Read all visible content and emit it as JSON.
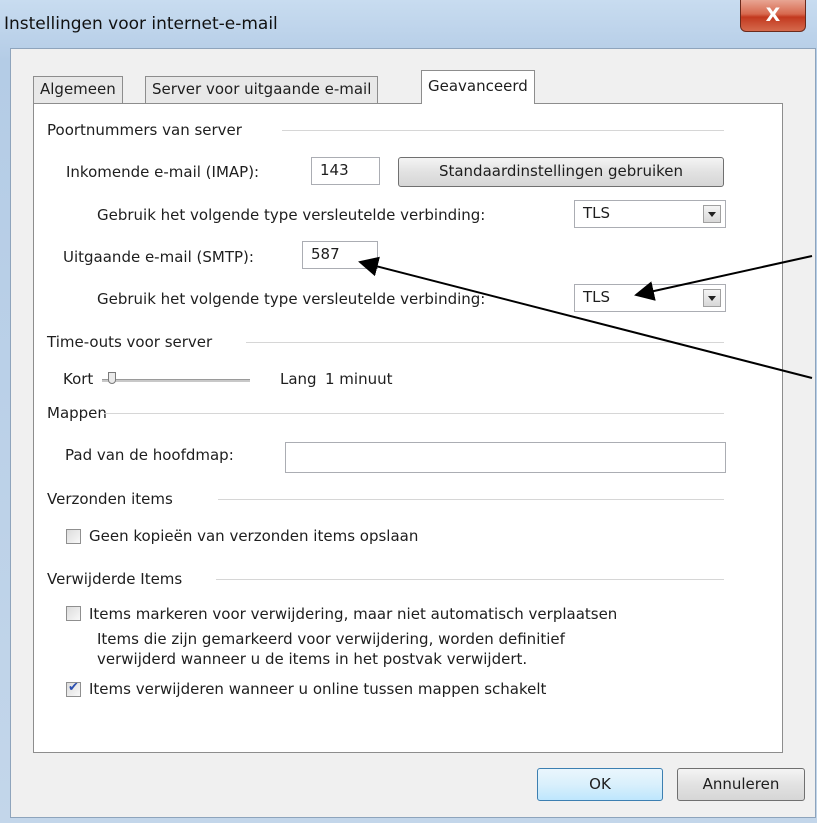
{
  "window": {
    "title": "Instellingen voor internet-e-mail",
    "close_symbol": "X"
  },
  "tabs": [
    {
      "label": "Algemeen",
      "active": false
    },
    {
      "label": "Server voor uitgaande e-mail",
      "active": false
    },
    {
      "label": "Geavanceerd",
      "active": true
    }
  ],
  "ports": {
    "group_label": "Poortnummers van server",
    "incoming_label": "Inkomende e-mail (IMAP):",
    "incoming_value": "143",
    "defaults_button": "Standaardinstellingen gebruiken",
    "incoming_enc_label": "Gebruik het volgende type versleutelde verbinding:",
    "incoming_enc_value": "TLS",
    "outgoing_label": "Uitgaande e-mail (SMTP):",
    "outgoing_value": "587",
    "outgoing_enc_label": "Gebruik het volgende type versleutelde verbinding:",
    "outgoing_enc_value": "TLS"
  },
  "timeouts": {
    "group_label": "Time-outs voor server",
    "short_label": "Kort",
    "long_label": "Lang",
    "value_text": "1 minuut"
  },
  "folders": {
    "group_label": "Mappen",
    "root_label": "Pad van de hoofdmap:",
    "root_value": ""
  },
  "sent": {
    "group_label": "Verzonden items",
    "no_copies_label": "Geen kopieën van verzonden items opslaan",
    "no_copies_checked": false
  },
  "deleted": {
    "group_label": "Verwijderde Items",
    "mark_label": "Items markeren voor verwijdering, maar niet automatisch verplaatsen",
    "mark_checked": false,
    "info_line1": "Items die zijn gemarkeerd voor verwijdering, worden definitief",
    "info_line2": "verwijderd wanneer u de items in het postvak verwijdert.",
    "purge_label": "Items verwijderen wanneer u online tussen mappen schakelt",
    "purge_checked": true,
    "check_symbol": "✔"
  },
  "footer": {
    "ok_label": "OK",
    "cancel_label": "Annuleren"
  }
}
